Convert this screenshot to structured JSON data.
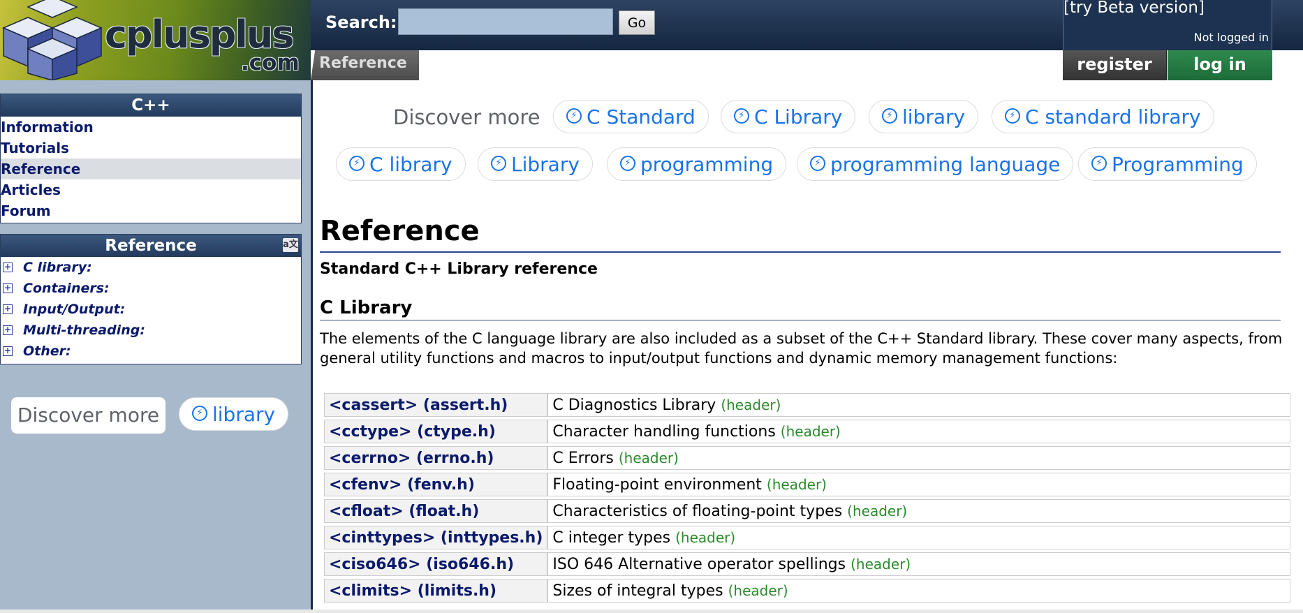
{
  "header": {
    "logo_text": "cplusplus",
    "logo_suffix": ".com",
    "search_label": "Search:",
    "search_value": "",
    "go_label": "Go",
    "beta_link": "[try Beta version]",
    "login_status": "Not logged in",
    "breadcrumb": "Reference",
    "register_label": "register",
    "login_label": "log in"
  },
  "sidebar": {
    "nav_title": "C++",
    "nav_items": [
      {
        "label": "Information"
      },
      {
        "label": "Tutorials"
      },
      {
        "label": "Reference"
      },
      {
        "label": "Articles"
      },
      {
        "label": "Forum"
      }
    ],
    "ref_title": "Reference",
    "ref_items": [
      {
        "label": "C library:"
      },
      {
        "label": "Containers:"
      },
      {
        "label": "Input/Output:"
      },
      {
        "label": "Multi-threading:"
      },
      {
        "label": "Other:"
      }
    ],
    "discover_label": "Discover more",
    "discover_chip": "library"
  },
  "discover": {
    "label": "Discover more",
    "chips": [
      "C Standard",
      "C Library",
      "library",
      "C standard library",
      "C library",
      "Library",
      "programming",
      "programming language",
      "Programming"
    ]
  },
  "main": {
    "title": "Reference",
    "subtitle": "Standard C++ Library reference",
    "section_heading": "C Library",
    "section_intro": "The elements of the C language library are also included as a subset of the C++ Standard library. These cover many aspects, from general utility functions and macros to input/output functions and dynamic memory management functions:",
    "headers": [
      {
        "name": "<cassert> (assert.h)",
        "desc": "C Diagnostics Library",
        "type": "(header)"
      },
      {
        "name": "<cctype> (ctype.h)",
        "desc": "Character handling functions",
        "type": "(header)"
      },
      {
        "name": "<cerrno> (errno.h)",
        "desc": "C Errors",
        "type": "(header)"
      },
      {
        "name": "<cfenv> (fenv.h)",
        "desc": "Floating-point environment",
        "type": "(header)"
      },
      {
        "name": "<cfloat> (float.h)",
        "desc": "Characteristics of floating-point types",
        "type": "(header)"
      },
      {
        "name": "<cinttypes> (inttypes.h)",
        "desc": "C integer types",
        "type": "(header)"
      },
      {
        "name": "<ciso646> (iso646.h)",
        "desc": "ISO 646 Alternative operator spellings",
        "type": "(header)"
      },
      {
        "name": "<climits> (limits.h)",
        "desc": "Sizes of integral types",
        "type": "(header)"
      }
    ]
  }
}
